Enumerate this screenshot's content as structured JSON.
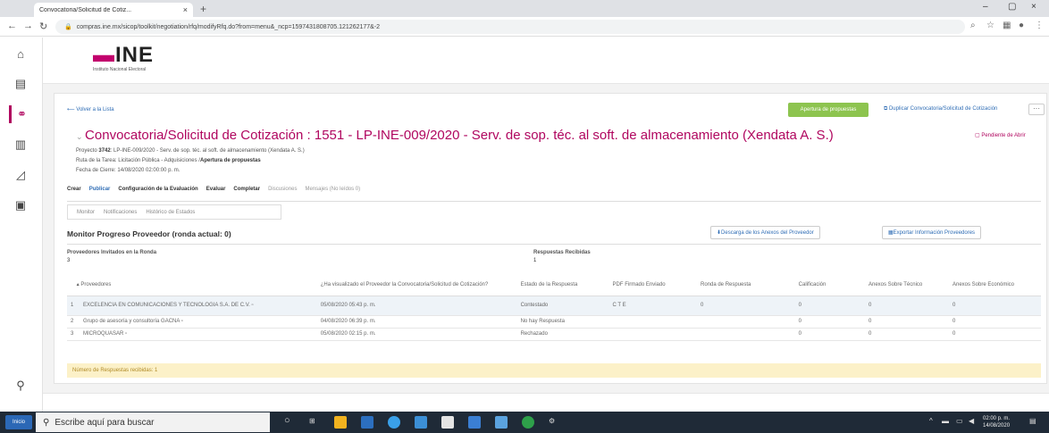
{
  "browser": {
    "tab_title": "Convocatoria/Solicitud de Cotiz...",
    "url": "compras.ine.mx/sicop/toolkit/negotiation/rfq/modifyRfq.do?from=menu&_ncp=1597431808705.121262177&-2"
  },
  "header": {
    "logo_text": "INE",
    "logo_sub": "Instituto Nacional Electoral"
  },
  "page": {
    "back_link": "Volver a la Lista",
    "btn_apertura": "Apertura de propuestas",
    "btn_duplicar": "Duplicar Convocatoria/Solicitud de Cotización",
    "title": "Convocatoria/Solicitud de Cotización : 1551 - LP-INE-009/2020 - Serv. de sop. téc. al soft. de almacenamiento (Xendata A. S.)",
    "pending": "Pendiente de Abrir",
    "proyecto_label": "Proyecto",
    "proyecto_num": "3742",
    "proyecto_rest": ": LP-INE-009/2020 - Serv. de sop. téc. al soft. de almacenamiento (Xendata A. S.)",
    "ruta_label": "Ruta de la Tarea: Licitación Pública - Adquisiciones /",
    "ruta_bold": "Apertura de propuestas",
    "fecha": "Fecha de Cierre: 14/08/2020 02:00:00 p. m.",
    "tabs": [
      "Crear",
      "Publicar",
      "Configuración de la Evaluación",
      "Evaluar",
      "Completar",
      "Discusiones",
      "Mensajes (No leídos 0)"
    ],
    "subtabs": [
      "Monitor",
      "Notificaciones",
      "Histórico de Estados"
    ],
    "section_title": "Monitor Progreso Proveedor (ronda actual: 0)",
    "btn_descargar": "Descarga de los Anexos del Proveedor",
    "btn_exportar": "Exportar Información Proveedores",
    "invitados_label": "Proveedores Invitados en la Ronda",
    "invitados_value": "3",
    "recibidas_label": "Respuestas Recibidas",
    "recibidas_value": "1",
    "footer_note": "Número de Respuestas recibidas: 1"
  },
  "table": {
    "headers": [
      "Proveedores",
      "¿Ha visualizado el Proveedor la Convocatoria/Solicitud de Cotización?",
      "Estado de la Respuesta",
      "PDF Firmado Enviado",
      "Ronda de Respuesta",
      "Calificación",
      "Anexos Sobre Técnico",
      "Anexos Sobre Económico"
    ],
    "rows": [
      [
        "1",
        "EXCELENCIA EN COMUNICACIONES Y TECNOLOGIA S.A. DE C.V.",
        "05/08/2020 05:43 p. m.",
        "Contestado",
        "C T E",
        "0",
        "0",
        "0",
        "0"
      ],
      [
        "2",
        "Grupo de asesoría y consultoría GACNA",
        "04/08/2020 06:39 p. m.",
        "No hay Respuesta",
        "",
        "",
        "0",
        "0",
        "0"
      ],
      [
        "3",
        "MICROQUASAR",
        "05/08/2020 02:15 p. m.",
        "Rechazado",
        "",
        "",
        "0",
        "0",
        "0"
      ]
    ]
  },
  "taskbar": {
    "start": "Inicio",
    "search_placeholder": "Escribe aquí para buscar",
    "time": "02:00 p. m.",
    "date": "14/08/2020"
  },
  "colors": {
    "brand": "#b0065f",
    "green": "#8dc44f",
    "link": "#2f6db5",
    "note_bg": "#fcf1c8"
  }
}
